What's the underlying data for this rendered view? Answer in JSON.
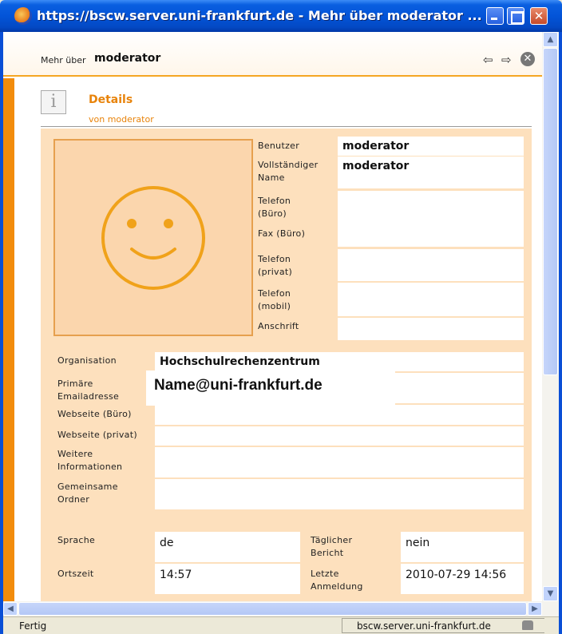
{
  "window": {
    "title": "https://bscw.server.uni-frankfurt.de - Mehr über moderator ...",
    "minimize_label": "",
    "maximize_label": "",
    "close_label": "✕"
  },
  "page_header": {
    "prefix": "Mehr über",
    "name": "moderator",
    "back_icon": "⇦",
    "forward_icon": "⇨",
    "close_icon": "⊗"
  },
  "details": {
    "icon_glyph": "i",
    "title": "Details",
    "subtitle": "von moderator"
  },
  "user_fields": [
    {
      "label": "Benutzer",
      "value": "moderator"
    },
    {
      "label": "Vollständiger Name",
      "value": "moderator"
    },
    {
      "label": "Telefon (Büro)",
      "value": ""
    },
    {
      "label": "Fax (Büro)",
      "value": ""
    },
    {
      "label": "Telefon (privat)",
      "value": ""
    },
    {
      "label": "Telefon (mobil)",
      "value": ""
    },
    {
      "label": "Anschrift",
      "value": ""
    }
  ],
  "org_fields": [
    {
      "label": "Organisation",
      "value": "Hochschulrechenzentrum"
    },
    {
      "label": "Primäre Emailadresse",
      "value": "Name@uni-frankfurt.de"
    },
    {
      "label": "Webseite (Büro)",
      "value": ""
    },
    {
      "label": "Webseite (privat)",
      "value": ""
    },
    {
      "label": "Weitere Informationen",
      "value": ""
    },
    {
      "label": "Gemeinsame Ordner",
      "value": ""
    }
  ],
  "bottom_fields": {
    "sprache_label": "Sprache",
    "sprache_value": "de",
    "bericht_label": "Täglicher Bericht",
    "bericht_value": "nein",
    "ortszeit_label": "Ortszeit",
    "ortszeit_value": "14:57",
    "anmeldung_label": "Letzte Anmeldung",
    "anmeldung_value": "2010-07-29 14:56"
  },
  "scrollbars": {
    "up": "▲",
    "down": "▼",
    "left": "◀",
    "right": "▶"
  },
  "statusbar": {
    "text": "Fertig",
    "host": "bscw.server.uni-frankfurt.de"
  },
  "colors": {
    "accent": "#f28c0c",
    "panel": "#fde0bd",
    "title_orange": "#e8830a",
    "titlebar_blue": "#0354d8"
  }
}
